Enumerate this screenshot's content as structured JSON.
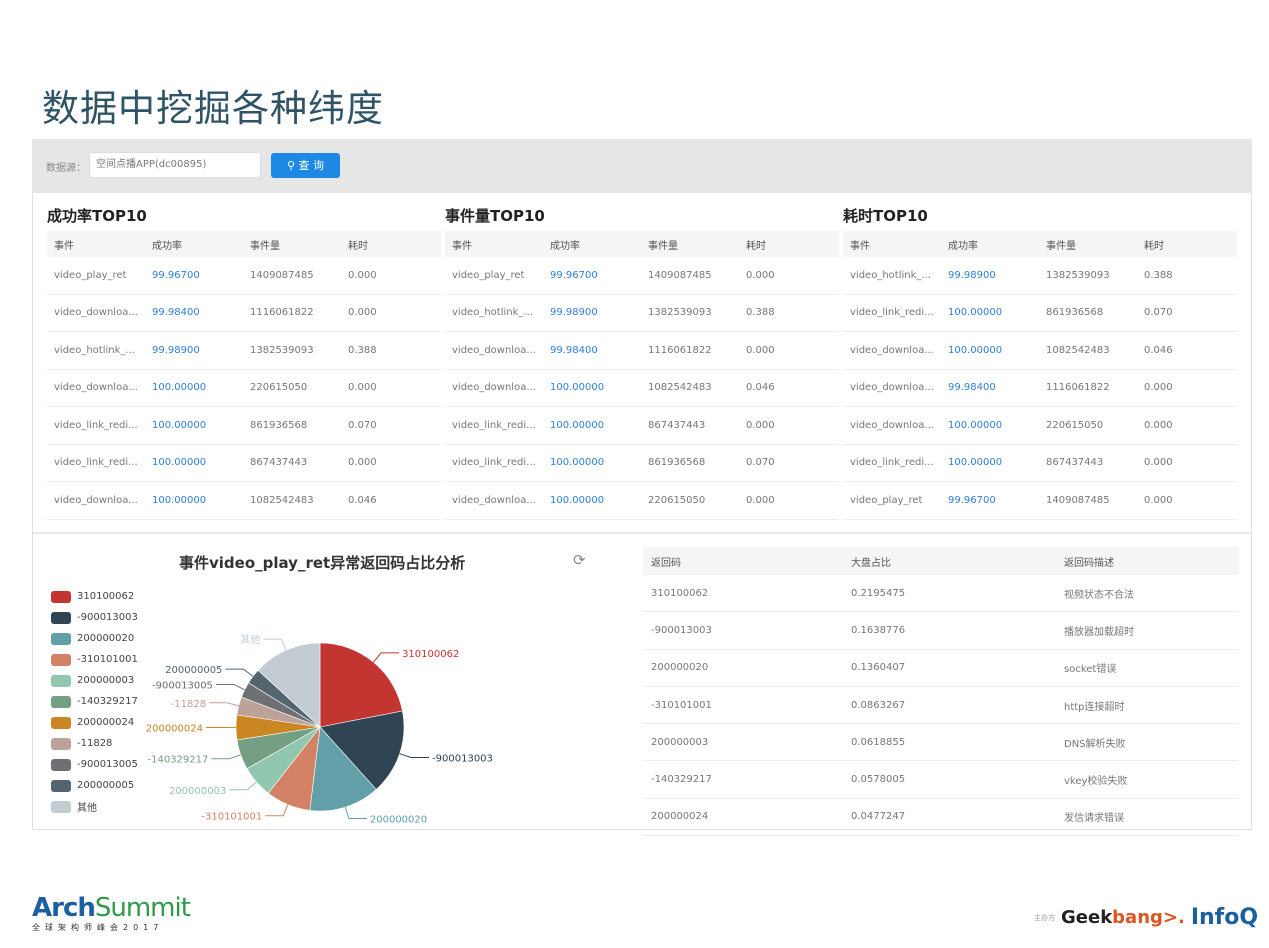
{
  "slide_title": "数据中挖掘各种纬度",
  "toolbar": {
    "datasource_label": "数据源：",
    "datasource_value": "空间点播APP(dc00895)",
    "query_label": "查 询",
    "query_icon": "search-icon"
  },
  "tables": [
    {
      "title": "成功率TOP10",
      "headers": [
        "事件",
        "成功率",
        "事件量",
        "耗时"
      ],
      "rows": [
        [
          "video_play_ret",
          "99.96700",
          "1409087485",
          "0.000"
        ],
        [
          "video_downloa...",
          "99.98400",
          "1116061822",
          "0.000"
        ],
        [
          "video_hotlink_...",
          "99.98900",
          "1382539093",
          "0.388"
        ],
        [
          "video_downloa...",
          "100.00000",
          "220615050",
          "0.000"
        ],
        [
          "video_link_redi...",
          "100.00000",
          "861936568",
          "0.070"
        ],
        [
          "video_link_redi...",
          "100.00000",
          "867437443",
          "0.000"
        ],
        [
          "video_downloa...",
          "100.00000",
          "1082542483",
          "0.046"
        ]
      ]
    },
    {
      "title": "事件量TOP10",
      "headers": [
        "事件",
        "成功率",
        "事件量",
        "耗时"
      ],
      "rows": [
        [
          "video_play_ret",
          "99.96700",
          "1409087485",
          "0.000"
        ],
        [
          "video_hotlink_...",
          "99.98900",
          "1382539093",
          "0.388"
        ],
        [
          "video_downloa...",
          "99.98400",
          "1116061822",
          "0.000"
        ],
        [
          "video_downloa...",
          "100.00000",
          "1082542483",
          "0.046"
        ],
        [
          "video_link_redi...",
          "100.00000",
          "867437443",
          "0.000"
        ],
        [
          "video_link_redi...",
          "100.00000",
          "861936568",
          "0.070"
        ],
        [
          "video_downloa...",
          "100.00000",
          "220615050",
          "0.000"
        ]
      ]
    },
    {
      "title": "耗时TOP10",
      "headers": [
        "事件",
        "成功率",
        "事件量",
        "耗时"
      ],
      "rows": [
        [
          "video_hotlink_...",
          "99.98900",
          "1382539093",
          "0.388"
        ],
        [
          "video_link_redi...",
          "100.00000",
          "861936568",
          "0.070"
        ],
        [
          "video_downloa...",
          "100.00000",
          "1082542483",
          "0.046"
        ],
        [
          "video_downloa...",
          "99.98400",
          "1116061822",
          "0.000"
        ],
        [
          "video_downloa...",
          "100.00000",
          "220615050",
          "0.000"
        ],
        [
          "video_link_redi...",
          "100.00000",
          "867437443",
          "0.000"
        ],
        [
          "video_play_ret",
          "99.96700",
          "1409087485",
          "0.000"
        ]
      ]
    }
  ],
  "chart_data": {
    "type": "pie",
    "title": "事件video_play_ret异常返回码占比分析",
    "legend_position": "left",
    "slices": [
      {
        "name": "310100062",
        "value": 0.2195475,
        "color": "#c23531"
      },
      {
        "name": "-900013003",
        "value": 0.1638776,
        "color": "#2f4554"
      },
      {
        "name": "200000020",
        "value": 0.1360407,
        "color": "#61a0a8"
      },
      {
        "name": "-310101001",
        "value": 0.0863267,
        "color": "#d48265"
      },
      {
        "name": "200000003",
        "value": 0.0618855,
        "color": "#91c7ae"
      },
      {
        "name": "-140329217",
        "value": 0.0578005,
        "color": "#749f83"
      },
      {
        "name": "200000024",
        "value": 0.0477247,
        "color": "#ca8622"
      },
      {
        "name": "-11828",
        "value": 0.035,
        "color": "#bda29a"
      },
      {
        "name": "-900013005",
        "value": 0.03,
        "color": "#6e7074"
      },
      {
        "name": "200000005",
        "value": 0.03,
        "color": "#546570"
      },
      {
        "name": "其他",
        "value": 0.132,
        "color": "#c4ccd3"
      }
    ]
  },
  "code_table": {
    "headers": [
      "返回码",
      "大盘占比",
      "返回码描述"
    ],
    "rows": [
      [
        "310100062",
        "0.2195475",
        "视频状态不合法"
      ],
      [
        "-900013003",
        "0.1638776",
        "播放器加载超时"
      ],
      [
        "200000020",
        "0.1360407",
        "socket错误"
      ],
      [
        "-310101001",
        "0.0863267",
        "http连接超时"
      ],
      [
        "200000003",
        "0.0618855",
        "DNS解析失败"
      ],
      [
        "-140329217",
        "0.0578005",
        "vkey校验失败"
      ],
      [
        "200000024",
        "0.0477247",
        "发信请求错误"
      ]
    ]
  },
  "footer": {
    "arch_a": "Arch",
    "arch_b": "Summit",
    "arch_sub": "全球架构师峰会2017",
    "host": "主办方",
    "geek_a": "Geek",
    "geek_b": "bang>.",
    "infoq": "InfoQ"
  }
}
